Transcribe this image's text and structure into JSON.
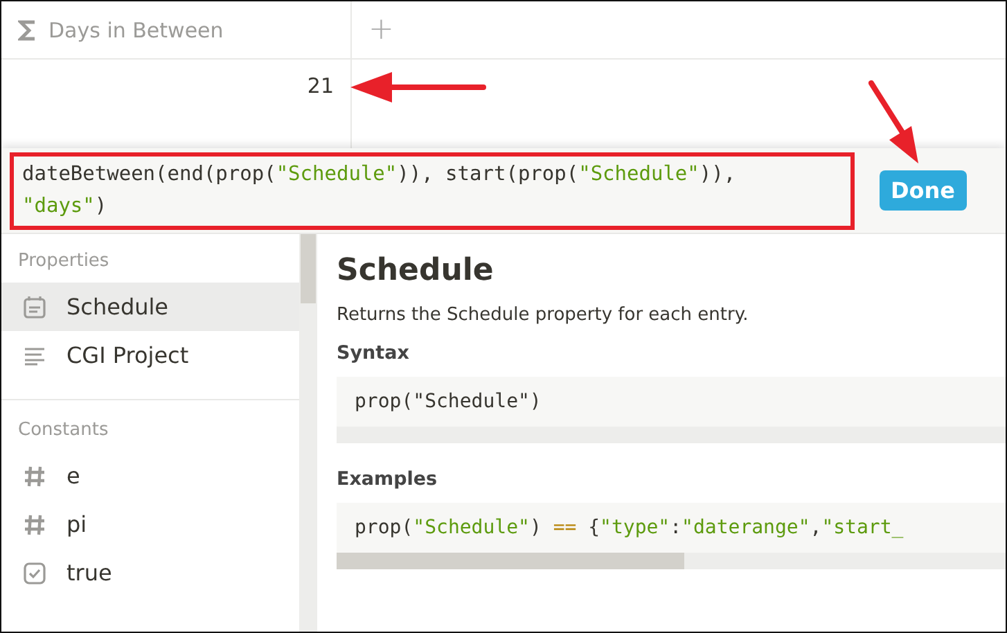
{
  "table": {
    "columns": [
      {
        "kind": "formula",
        "label": "Days in Between"
      },
      {
        "kind": "add",
        "label": "+"
      }
    ],
    "rows": [
      {
        "value": "21"
      }
    ]
  },
  "formula": {
    "lines": [
      [
        {
          "kind": "plain",
          "text": "dateBetween(end(prop("
        },
        {
          "kind": "string",
          "text": "\"Schedule\""
        },
        {
          "kind": "plain",
          "text": ")), start(prop("
        },
        {
          "kind": "string",
          "text": "\"Schedule\""
        },
        {
          "kind": "plain",
          "text": ")),"
        }
      ],
      [
        {
          "kind": "string",
          "text": "\"days\""
        },
        {
          "kind": "plain",
          "text": ")"
        }
      ]
    ],
    "button": "Done"
  },
  "sidebar": {
    "sections": [
      {
        "title": "Properties",
        "items": [
          {
            "kind": "date",
            "label": "Schedule",
            "selected": true
          },
          {
            "kind": "text",
            "label": "CGI Project",
            "selected": false
          }
        ]
      },
      {
        "title": "Constants",
        "items": [
          {
            "kind": "number",
            "label": "e",
            "selected": false
          },
          {
            "kind": "number",
            "label": "pi",
            "selected": false
          },
          {
            "kind": "checkbox",
            "label": "true",
            "selected": false
          }
        ]
      }
    ]
  },
  "detail": {
    "title": "Schedule",
    "description": "Returns the Schedule property for each entry.",
    "syntax_label": "Syntax",
    "syntax": "prop(\"Schedule\")",
    "examples_label": "Examples",
    "example": [
      {
        "kind": "plain",
        "text": "prop("
      },
      {
        "kind": "string",
        "text": "\"Schedule\""
      },
      {
        "kind": "plain",
        "text": ") "
      },
      {
        "kind": "operator",
        "text": "=="
      },
      {
        "kind": "plain",
        "text": " {"
      },
      {
        "kind": "string",
        "text": "\"type\""
      },
      {
        "kind": "plain",
        "text": ":"
      },
      {
        "kind": "string",
        "text": "\"daterange\""
      },
      {
        "kind": "plain",
        "text": ","
      },
      {
        "kind": "string",
        "text": "\"start_"
      }
    ]
  }
}
